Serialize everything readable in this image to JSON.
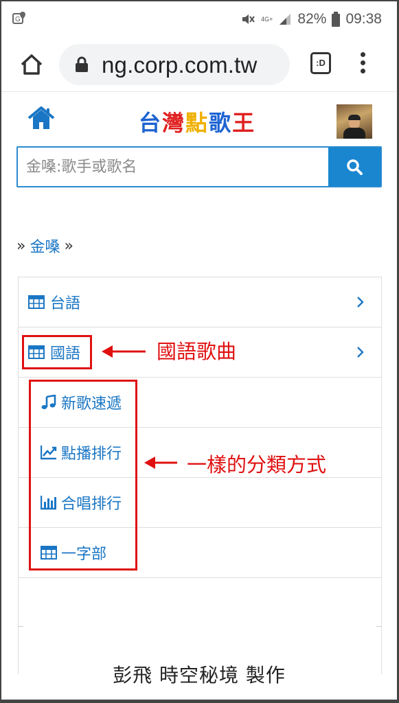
{
  "status_bar": {
    "network": "4G+",
    "battery": "82%",
    "time": "09:38"
  },
  "browser": {
    "url": "ng.corp.com.tw",
    "tab_label": ":D"
  },
  "site": {
    "title_chars": [
      {
        "char": "台",
        "color": "#1e64d2"
      },
      {
        "char": "灣",
        "color": "#e02020"
      },
      {
        "char": "點",
        "color": "#f0b000"
      },
      {
        "char": "歌",
        "color": "#1e64d2"
      },
      {
        "char": "王",
        "color": "#e02020"
      }
    ]
  },
  "search": {
    "placeholder": "金嗓:歌手或歌名"
  },
  "breadcrumb": {
    "sep1": "»",
    "link": "金嗓",
    "sep2": "»"
  },
  "menu": {
    "items": [
      {
        "label": "台語"
      },
      {
        "label": "國語"
      }
    ],
    "sub_items": [
      {
        "label": "新歌速遞",
        "icon": "music-note-icon"
      },
      {
        "label": "點播排行",
        "icon": "line-chart-icon"
      },
      {
        "label": "合唱排行",
        "icon": "bar-chart-icon"
      },
      {
        "label": "一字部",
        "icon": "table-icon"
      }
    ]
  },
  "annotations": {
    "mandarin_songs": "國語歌曲",
    "same_categories": "一樣的分類方式"
  },
  "footer": {
    "credit": "彭飛 時空秘境 製作"
  },
  "colors": {
    "accent": "#1a76c4",
    "search_button": "#1a86d0",
    "annotation_red": "#e01010"
  }
}
